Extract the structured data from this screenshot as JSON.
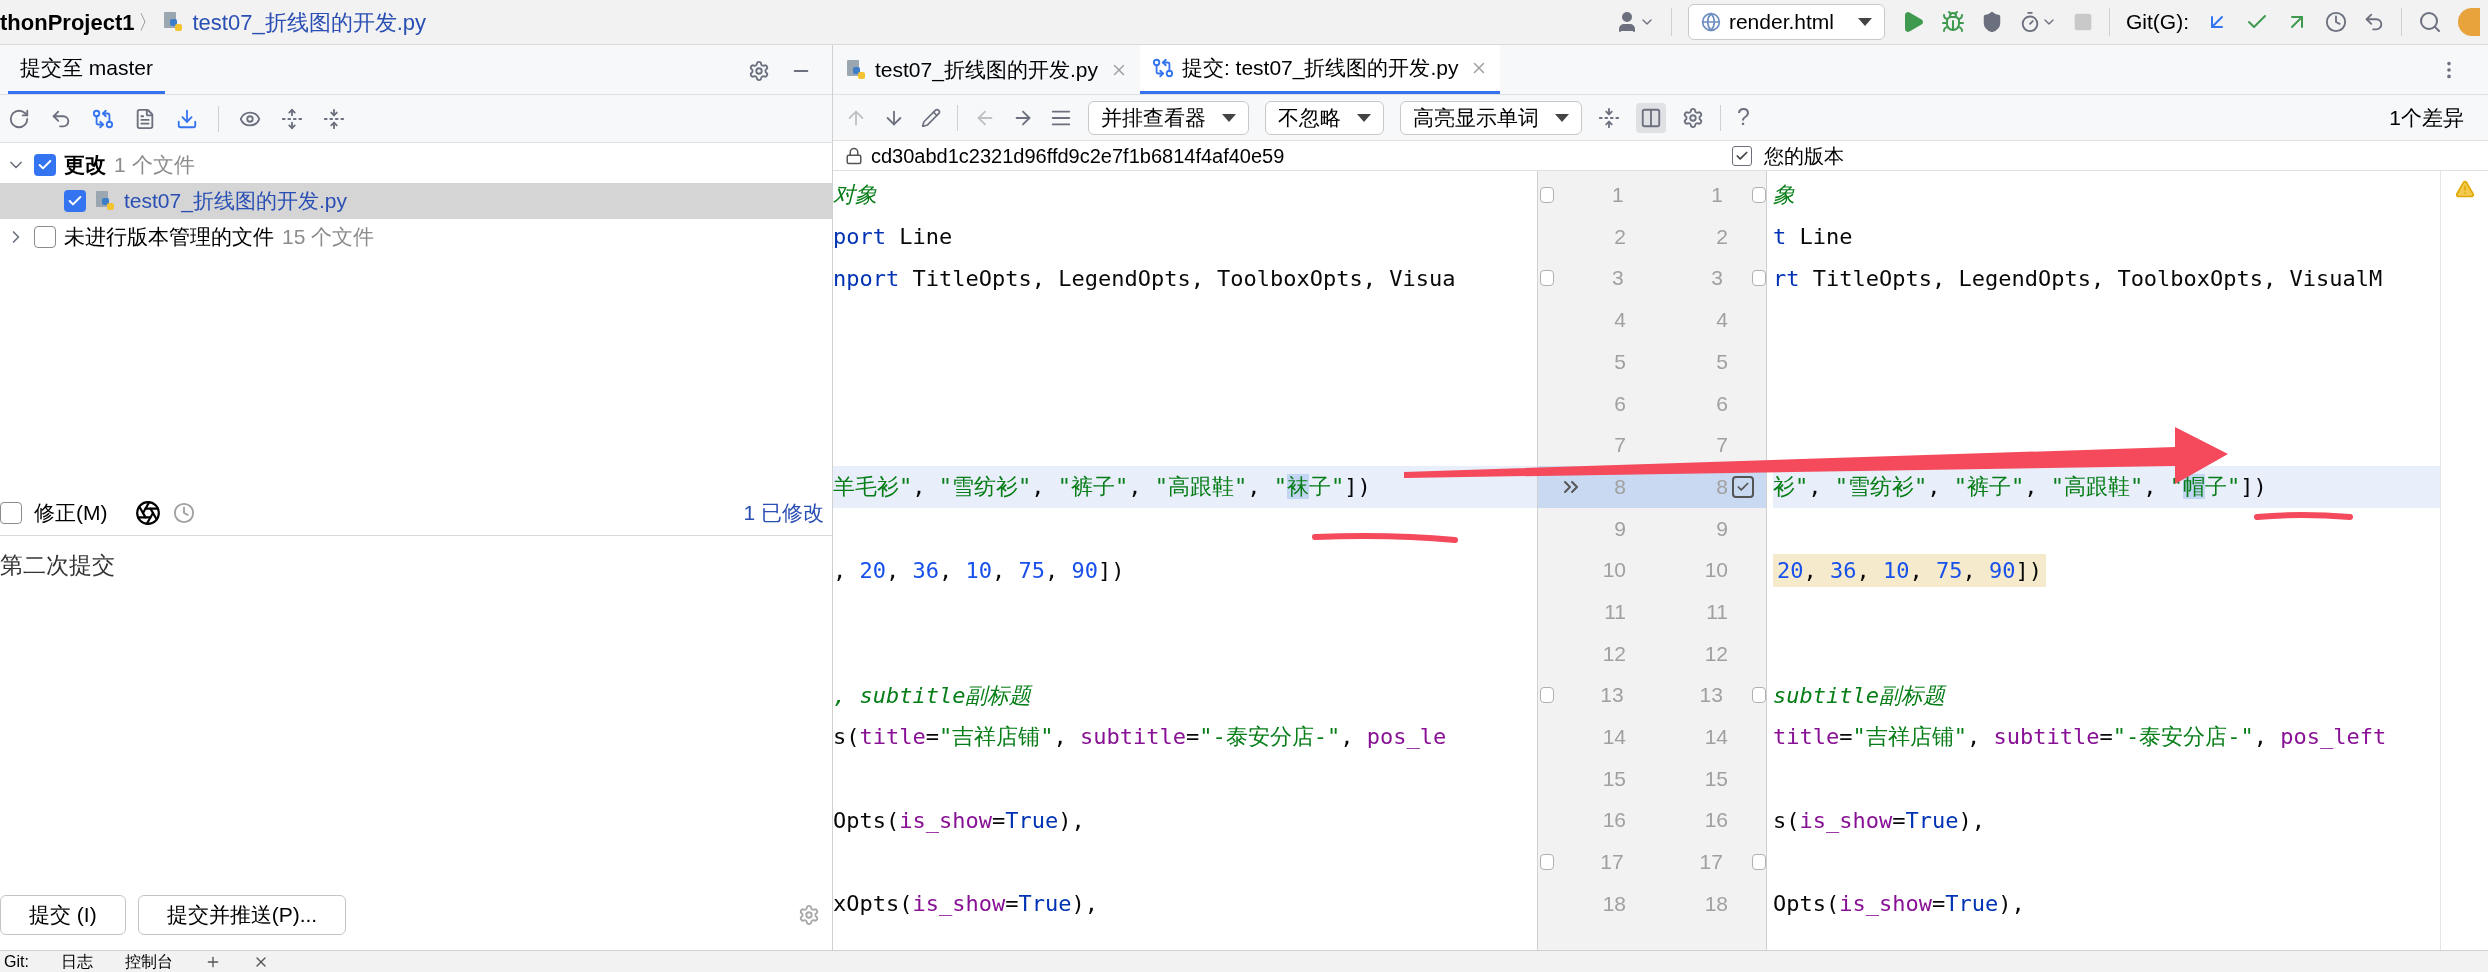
{
  "breadcrumb": {
    "project": "thonProject1",
    "separator": "〉",
    "file": "test07_折线图的开发.py"
  },
  "run_config": "render.html",
  "git_label": "Git(G):",
  "commit_panel": {
    "tab": "提交至 master",
    "tree": [
      {
        "label": "更改",
        "count": "1 个文件",
        "checked": true,
        "expanded": true,
        "bold": true,
        "children": [
          {
            "label": "test07_折线图的开发.py",
            "checked": true,
            "selected": true
          }
        ]
      },
      {
        "label": "未进行版本管理的文件",
        "count": "15 个文件",
        "checked": false,
        "expanded": false,
        "bold": false
      }
    ],
    "amend": {
      "label": "修正(M)",
      "checked": false
    },
    "modified": "1 已修改",
    "message": "第二次提交",
    "buttons": [
      "提交 (I)",
      "提交并推送(P)..."
    ]
  },
  "editor_tabs": [
    {
      "label": "test07_折线图的开发.py",
      "kind": "file",
      "selected": false
    },
    {
      "label": "提交: test07_折线图的开发.py",
      "kind": "diff",
      "selected": true
    }
  ],
  "diff_toolbar": {
    "dropdowns": [
      "并排查看器",
      "不忽略",
      "高亮显示单词"
    ],
    "help": "?",
    "diff_count": "1个差异"
  },
  "left_header": "cd30abd1c2321d96ffd9c2e7f1b6814f4af40e59",
  "right_header": {
    "label": "您的版本",
    "checked": true
  },
  "lines": [
    {
      "left_no": "1",
      "right_no": "1",
      "changed": false,
      "fold": true,
      "left": [
        {
          "kind": "comment",
          "text": "对象"
        }
      ],
      "right": [
        {
          "kind": "comment",
          "text": "象"
        }
      ]
    },
    {
      "left_no": "2",
      "right_no": "2",
      "changed": false,
      "left": [
        {
          "kind": "keyword",
          "text": "port"
        },
        {
          "kind": "plain",
          "text": " Line"
        }
      ],
      "right": [
        {
          "kind": "keyword",
          "text": "t"
        },
        {
          "kind": "plain",
          "text": " Line"
        }
      ]
    },
    {
      "left_no": "3",
      "right_no": "3",
      "changed": false,
      "fold": true,
      "left": [
        {
          "kind": "keyword",
          "text": "nport"
        },
        {
          "kind": "plain",
          "text": " TitleOpts, LegendOpts, ToolboxOpts, Visua"
        }
      ],
      "right": [
        {
          "kind": "keyword",
          "text": "rt"
        },
        {
          "kind": "plain",
          "text": " TitleOpts, LegendOpts, ToolboxOpts, VisualM"
        }
      ]
    },
    {
      "left_no": "4",
      "right_no": "4",
      "changed": false
    },
    {
      "left_no": "5",
      "right_no": "5",
      "changed": false
    },
    {
      "left_no": "6",
      "right_no": "6",
      "changed": false
    },
    {
      "left_no": "7",
      "right_no": "7",
      "changed": false
    },
    {
      "left_no": "8",
      "right_no": "8",
      "changed": true,
      "included": true,
      "left": [
        {
          "kind": "string",
          "text": "羊毛衫\""
        },
        {
          "kind": "plain",
          "text": ", "
        },
        {
          "kind": "string",
          "text": "\"雪纺衫\""
        },
        {
          "kind": "plain",
          "text": ", "
        },
        {
          "kind": "string",
          "text": "\"裤子\""
        },
        {
          "kind": "plain",
          "text": ", "
        },
        {
          "kind": "string",
          "text": "\"高跟鞋\""
        },
        {
          "kind": "plain",
          "text": ", "
        },
        {
          "kind": "string",
          "text": "\""
        },
        {
          "kind": "string",
          "text": "袜",
          "changed": true
        },
        {
          "kind": "string",
          "text": "子\""
        },
        {
          "kind": "plain",
          "text": "])"
        }
      ],
      "right": [
        {
          "kind": "string",
          "text": "衫\""
        },
        {
          "kind": "plain",
          "text": ", "
        },
        {
          "kind": "string",
          "text": "\"雪纺衫\""
        },
        {
          "kind": "plain",
          "text": ", "
        },
        {
          "kind": "string",
          "text": "\"裤子\""
        },
        {
          "kind": "plain",
          "text": ", "
        },
        {
          "kind": "string",
          "text": "\"高跟鞋\""
        },
        {
          "kind": "plain",
          "text": ", "
        },
        {
          "kind": "string",
          "text": "\""
        },
        {
          "kind": "string",
          "text": "帽",
          "changed": true
        },
        {
          "kind": "string",
          "text": "子\""
        },
        {
          "kind": "plain",
          "text": "])"
        }
      ]
    },
    {
      "left_no": "9",
      "right_no": "9",
      "changed": false
    },
    {
      "left_no": "10",
      "right_no": "10",
      "changed": false,
      "right_warning": true,
      "left": [
        {
          "kind": "plain",
          "text": ", "
        },
        {
          "kind": "number",
          "text": "20"
        },
        {
          "kind": "plain",
          "text": ", "
        },
        {
          "kind": "number",
          "text": "36"
        },
        {
          "kind": "plain",
          "text": ", "
        },
        {
          "kind": "number",
          "text": "10"
        },
        {
          "kind": "plain",
          "text": ", "
        },
        {
          "kind": "number",
          "text": "75"
        },
        {
          "kind": "plain",
          "text": ", "
        },
        {
          "kind": "number",
          "text": "90"
        },
        {
          "kind": "plain",
          "text": "])"
        }
      ],
      "right": [
        {
          "kind": "number",
          "text": "20"
        },
        {
          "kind": "plain",
          "text": ", "
        },
        {
          "kind": "number",
          "text": "36"
        },
        {
          "kind": "plain",
          "text": ", "
        },
        {
          "kind": "number",
          "text": "10"
        },
        {
          "kind": "plain",
          "text": ", "
        },
        {
          "kind": "number",
          "text": "75"
        },
        {
          "kind": "plain",
          "text": ", "
        },
        {
          "kind": "number",
          "text": "90"
        },
        {
          "kind": "plain",
          "text": "])"
        }
      ]
    },
    {
      "left_no": "11",
      "right_no": "11",
      "changed": false
    },
    {
      "left_no": "12",
      "right_no": "12",
      "changed": false
    },
    {
      "left_no": "13",
      "right_no": "13",
      "changed": false,
      "fold": true,
      "left": [
        {
          "kind": "comment",
          "text": ", subtitle副标题"
        }
      ],
      "right": [
        {
          "kind": "comment",
          "text": "subtitle副标题"
        }
      ]
    },
    {
      "left_no": "14",
      "right_no": "14",
      "changed": false,
      "left": [
        {
          "kind": "plain",
          "text": "s("
        },
        {
          "kind": "param",
          "text": "title"
        },
        {
          "kind": "plain",
          "text": "="
        },
        {
          "kind": "string",
          "text": "\"吉祥店铺\""
        },
        {
          "kind": "plain",
          "text": ", "
        },
        {
          "kind": "param",
          "text": "subtitle"
        },
        {
          "kind": "plain",
          "text": "="
        },
        {
          "kind": "string",
          "text": "\"-泰安分店-\""
        },
        {
          "kind": "plain",
          "text": ", "
        },
        {
          "kind": "param",
          "text": "pos_le"
        }
      ],
      "right": [
        {
          "kind": "param",
          "text": "title"
        },
        {
          "kind": "plain",
          "text": "="
        },
        {
          "kind": "string",
          "text": "\"吉祥店铺\""
        },
        {
          "kind": "plain",
          "text": ", "
        },
        {
          "kind": "param",
          "text": "subtitle"
        },
        {
          "kind": "plain",
          "text": "="
        },
        {
          "kind": "string",
          "text": "\"-泰安分店-\""
        },
        {
          "kind": "plain",
          "text": ", "
        },
        {
          "kind": "param",
          "text": "pos_left"
        }
      ]
    },
    {
      "left_no": "15",
      "right_no": "15",
      "changed": false
    },
    {
      "left_no": "16",
      "right_no": "16",
      "changed": false,
      "left": [
        {
          "kind": "plain",
          "text": "Opts("
        },
        {
          "kind": "param",
          "text": "is_show"
        },
        {
          "kind": "plain",
          "text": "="
        },
        {
          "kind": "keyword",
          "text": "True"
        },
        {
          "kind": "plain",
          "text": "),"
        }
      ],
      "right": [
        {
          "kind": "plain",
          "text": "s("
        },
        {
          "kind": "param",
          "text": "is_show"
        },
        {
          "kind": "plain",
          "text": "="
        },
        {
          "kind": "keyword",
          "text": "True"
        },
        {
          "kind": "plain",
          "text": "),"
        }
      ]
    },
    {
      "left_no": "17",
      "right_no": "17",
      "changed": false,
      "fold": true
    },
    {
      "left_no": "18",
      "right_no": "18",
      "changed": false,
      "left": [
        {
          "kind": "plain",
          "text": "xOpts("
        },
        {
          "kind": "param",
          "text": "is_show"
        },
        {
          "kind": "plain",
          "text": "="
        },
        {
          "kind": "keyword",
          "text": "True"
        },
        {
          "kind": "plain",
          "text": "),"
        }
      ],
      "right": [
        {
          "kind": "plain",
          "text": "Opts("
        },
        {
          "kind": "param",
          "text": "is_show"
        },
        {
          "kind": "plain",
          "text": "="
        },
        {
          "kind": "keyword",
          "text": "True"
        },
        {
          "kind": "plain",
          "text": "),"
        }
      ]
    }
  ],
  "bottom_bar": [
    "Git:",
    "日志",
    "控制台"
  ]
}
